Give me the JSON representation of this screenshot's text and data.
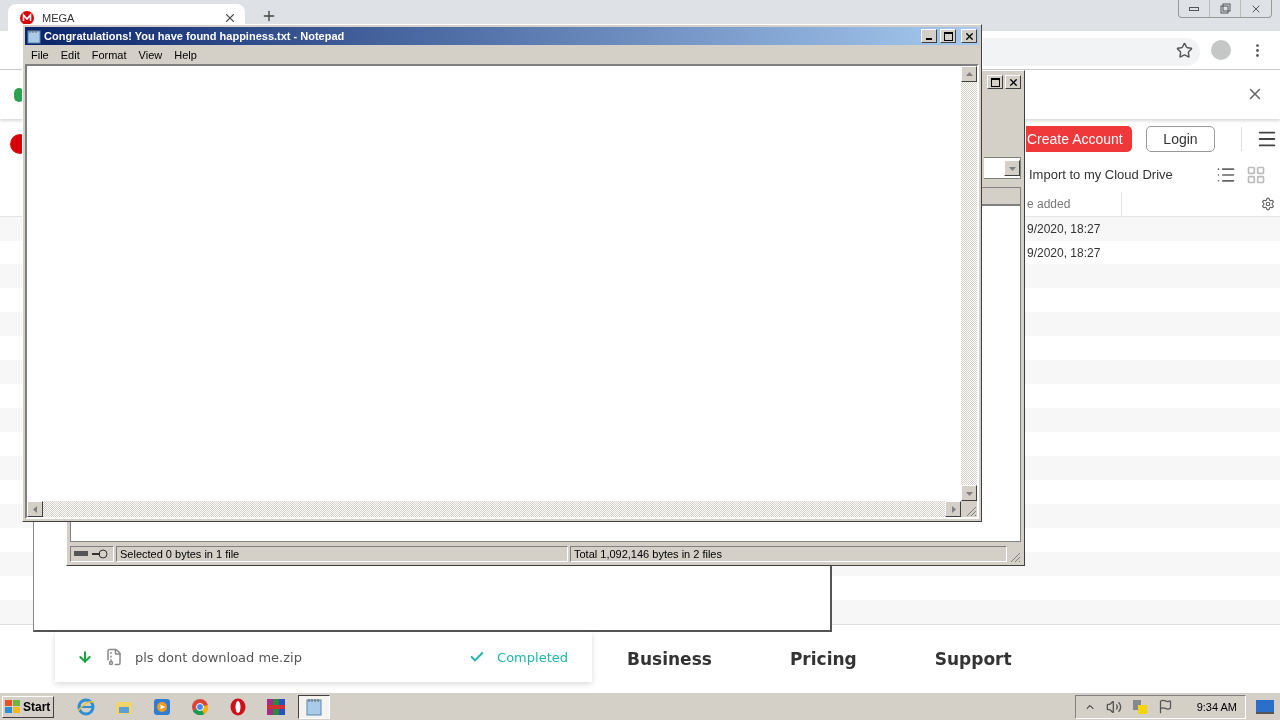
{
  "browser": {
    "tab": {
      "title": "MEGA"
    },
    "page": {
      "header_buttons": [
        {
          "label": "Create Account",
          "kind": "primary"
        },
        {
          "label": "Login",
          "kind": "outline"
        }
      ],
      "toolbar": {
        "action": "Import to my Cloud Drive"
      },
      "table": {
        "columns": [
          "e added"
        ],
        "rows": [
          {
            "date": "9/2020, 18:27"
          },
          {
            "date": "9/2020, 18:27"
          }
        ]
      },
      "footer_nav": [
        "Business",
        "Pricing",
        "Support"
      ]
    },
    "download": {
      "file": "pls dont download me.zip",
      "status": "Completed"
    }
  },
  "archiver_window": {
    "status_bar": [
      "Selected 0 bytes in 1 file",
      "Total 1,092,146 bytes in 2 files"
    ]
  },
  "notepad": {
    "title": "Congratulations! You have found happiness.txt - Notepad",
    "menu": [
      "File",
      "Edit",
      "Format",
      "View",
      "Help"
    ]
  },
  "taskbar": {
    "start": "Start",
    "apps": [
      {
        "kind": "ie",
        "selected": false
      },
      {
        "kind": "explorer",
        "selected": false
      },
      {
        "kind": "media",
        "selected": false
      },
      {
        "kind": "chrome",
        "selected": false
      },
      {
        "kind": "opera",
        "selected": false
      },
      {
        "kind": "winrar",
        "selected": false
      },
      {
        "kind": "notepad",
        "selected": true
      }
    ],
    "clock": "9:34 AM"
  }
}
